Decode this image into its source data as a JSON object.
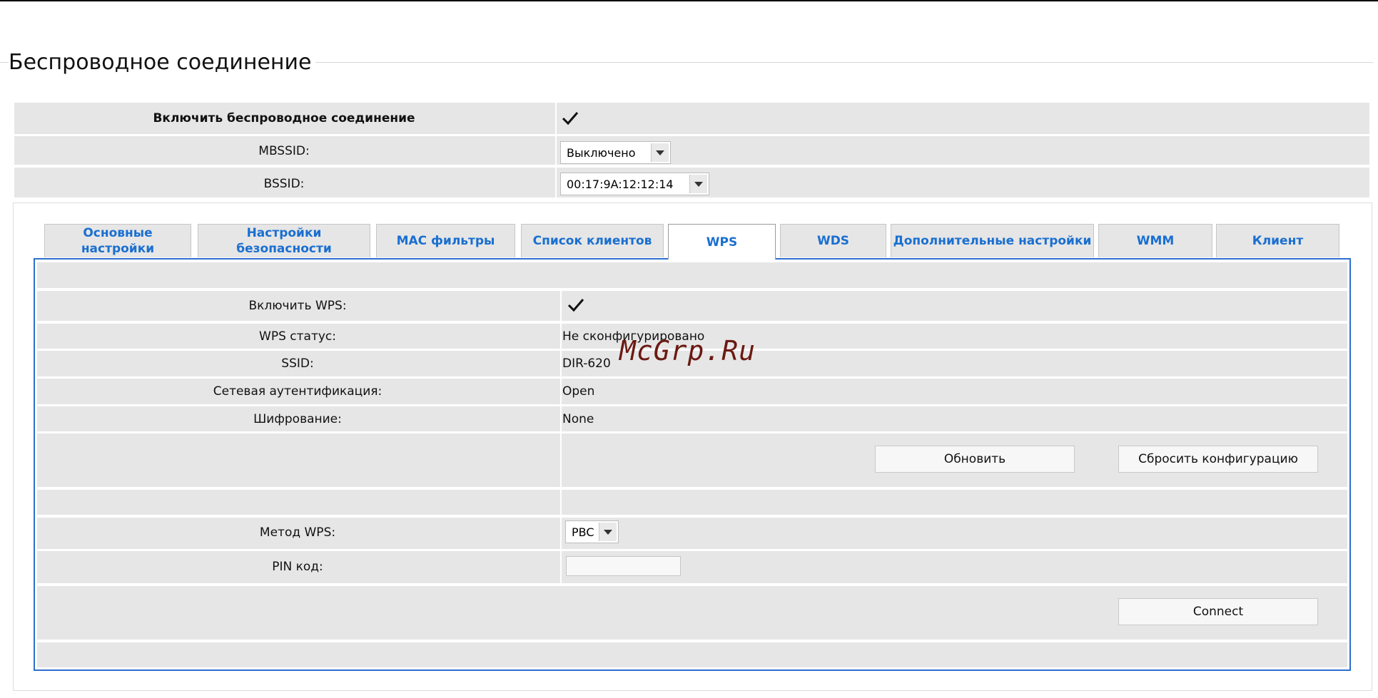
{
  "page": {
    "title": "Беспроводное соединение"
  },
  "general": {
    "enable_wireless_label": "Включить беспроводное соединение",
    "enable_wireless_checked": true,
    "mbssid_label": "MBSSID:",
    "mbssid_value": "Выключено",
    "bssid_label": "BSSID:",
    "bssid_value": "00:17:9A:12:12:14"
  },
  "tabs": [
    {
      "label": "Основные настройки",
      "active": false
    },
    {
      "label": "Настройки безопасности",
      "active": false
    },
    {
      "label": "MAC фильтры",
      "active": false
    },
    {
      "label": "Список клиентов",
      "active": false
    },
    {
      "label": "WPS",
      "active": true
    },
    {
      "label": "WDS",
      "active": false
    },
    {
      "label": "Дополнительные настройки",
      "active": false
    },
    {
      "label": "WMM",
      "active": false
    },
    {
      "label": "Клиент",
      "active": false
    }
  ],
  "wps": {
    "enable_label": "Включить WPS:",
    "enable_checked": true,
    "status_label": "WPS статус:",
    "status_value": "Не сконфигурировано",
    "ssid_label": "SSID:",
    "ssid_value": "DIR-620",
    "auth_label": "Сетевая аутентификация:",
    "auth_value": "Open",
    "encryption_label": "Шифрование:",
    "encryption_value": "None",
    "refresh_button": "Обновить",
    "reset_button": "Сбросить конфигурацию",
    "method_label": "Метод WPS:",
    "method_value": "PBC",
    "pin_label": "PIN код:",
    "pin_value": "",
    "connect_button": "Connect"
  },
  "watermark": "McGrp.Ru",
  "colors": {
    "tab_text": "#1a6fd0",
    "panel_border": "#2d6fcf",
    "row_bg": "#e6e6e6"
  }
}
